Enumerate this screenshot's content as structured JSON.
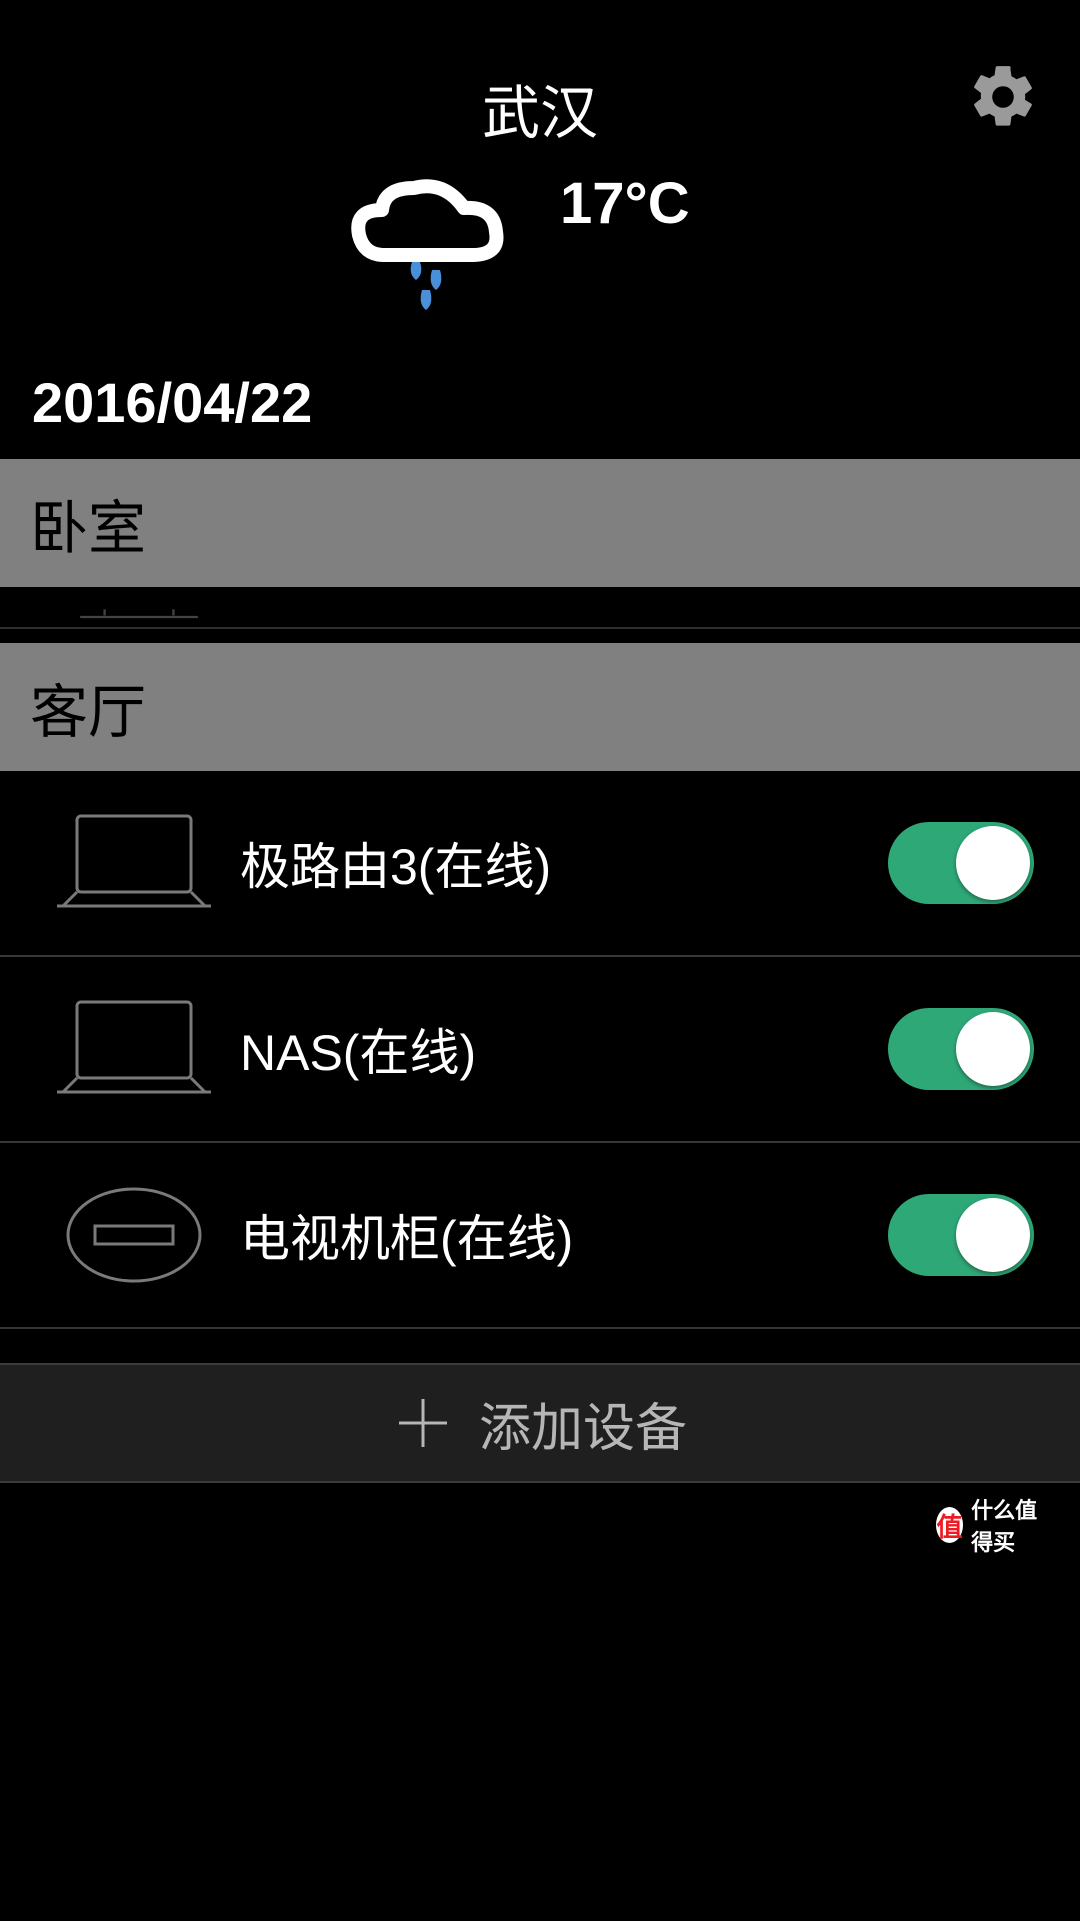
{
  "header": {
    "city": "武汉"
  },
  "weather": {
    "temperature": "17°C",
    "date": "2016/04/22"
  },
  "sections": {
    "bedroom": {
      "label": "卧室"
    },
    "living": {
      "label": "客厅"
    }
  },
  "devices": {
    "0": {
      "label": "极路由3(在线)"
    },
    "1": {
      "label": "NAS(在线)"
    },
    "2": {
      "label": "电视机柜(在线)"
    }
  },
  "footer": {
    "add_label": "添加设备"
  },
  "watermark": {
    "bubble": "值",
    "text": "什么值得买"
  }
}
